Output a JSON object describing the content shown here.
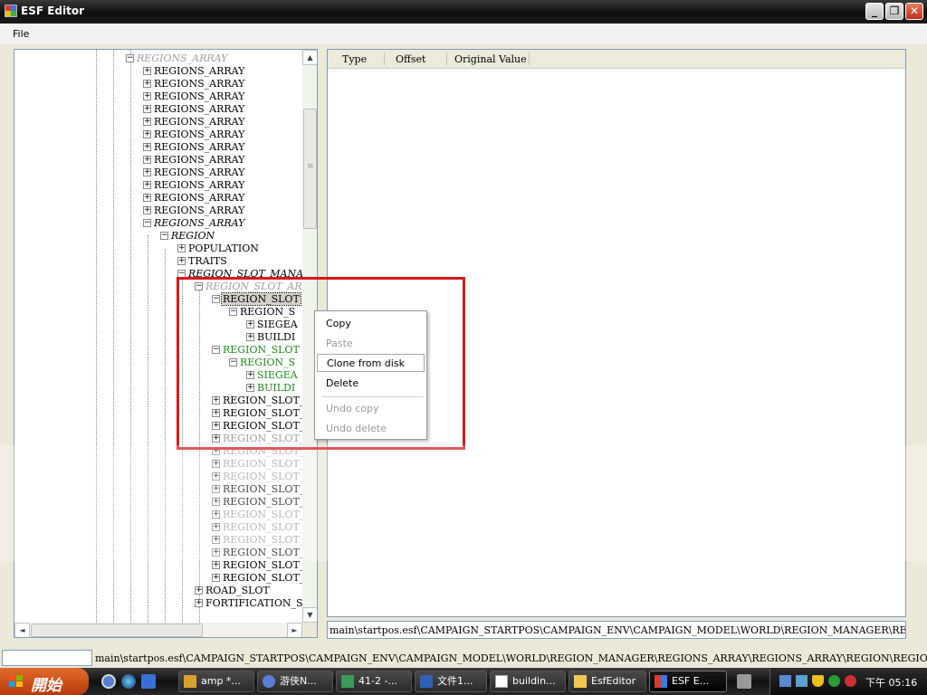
{
  "window": {
    "title": "ESF Editor",
    "min_glyph": "_",
    "max_glyph": "❐",
    "close_glyph": "✕"
  },
  "menu": {
    "file": "File"
  },
  "tree": {
    "nodes": [
      {
        "text": "REGIONS_ARRAY",
        "style": "gray italic",
        "exp": "−",
        "indent": 0
      },
      {
        "text": "REGIONS_ARRAY",
        "style": "",
        "exp": "+",
        "indent": 1
      },
      {
        "text": "REGIONS_ARRAY",
        "style": "",
        "exp": "+",
        "indent": 1
      },
      {
        "text": "REGIONS_ARRAY",
        "style": "",
        "exp": "+",
        "indent": 1
      },
      {
        "text": "REGIONS_ARRAY",
        "style": "",
        "exp": "+",
        "indent": 1
      },
      {
        "text": "REGIONS_ARRAY",
        "style": "",
        "exp": "+",
        "indent": 1
      },
      {
        "text": "REGIONS_ARRAY",
        "style": "",
        "exp": "+",
        "indent": 1
      },
      {
        "text": "REGIONS_ARRAY",
        "style": "",
        "exp": "+",
        "indent": 1
      },
      {
        "text": "REGIONS_ARRAY",
        "style": "",
        "exp": "+",
        "indent": 1
      },
      {
        "text": "REGIONS_ARRAY",
        "style": "",
        "exp": "+",
        "indent": 1
      },
      {
        "text": "REGIONS_ARRAY",
        "style": "",
        "exp": "+",
        "indent": 1
      },
      {
        "text": "REGIONS_ARRAY",
        "style": "",
        "exp": "+",
        "indent": 1
      },
      {
        "text": "REGIONS_ARRAY",
        "style": "",
        "exp": "+",
        "indent": 1
      },
      {
        "text": "REGIONS_ARRAY",
        "style": "italic",
        "exp": "−",
        "indent": 1
      },
      {
        "text": "REGION",
        "style": "italic",
        "exp": "−",
        "indent": 2
      },
      {
        "text": "POPULATION",
        "style": "",
        "exp": "+",
        "indent": 3
      },
      {
        "text": "TRAITS",
        "style": "",
        "exp": "+",
        "indent": 3
      },
      {
        "text": "REGION_SLOT_MANAG",
        "style": "italic",
        "exp": "−",
        "indent": 3
      },
      {
        "text": "REGION_SLOT_ARR",
        "style": "gray italic",
        "exp": "−",
        "indent": 4
      },
      {
        "text": "REGION_SLOT",
        "style": "sel",
        "exp": "−",
        "indent": 5
      },
      {
        "text": "REGION_S",
        "style": "",
        "exp": "−",
        "indent": 6
      },
      {
        "text": "SIEGEA",
        "style": "",
        "exp": "+",
        "indent": 7
      },
      {
        "text": "BUILDI",
        "style": "",
        "exp": "+",
        "indent": 7
      },
      {
        "text": "REGION_SLOT",
        "style": "green",
        "exp": "−",
        "indent": 5
      },
      {
        "text": "REGION_S",
        "style": "green",
        "exp": "−",
        "indent": 6
      },
      {
        "text": "SIEGEA",
        "style": "green",
        "exp": "+",
        "indent": 7
      },
      {
        "text": "BUILDI",
        "style": "green",
        "exp": "+",
        "indent": 7
      },
      {
        "text": "REGION_SLOT_",
        "style": "",
        "exp": "+",
        "indent": 5
      },
      {
        "text": "REGION_SLOT_",
        "style": "",
        "exp": "+",
        "indent": 5
      },
      {
        "text": "REGION_SLOT_",
        "style": "",
        "exp": "+",
        "indent": 5
      },
      {
        "text": "REGION_SLOT_",
        "style": "gray",
        "exp": "+",
        "indent": 5
      },
      {
        "text": "REGION_SLOT_",
        "style": "gray",
        "exp": "+",
        "indent": 5
      },
      {
        "text": "REGION_SLOT_",
        "style": "gray",
        "exp": "+",
        "indent": 5
      },
      {
        "text": "REGION_SLOT_",
        "style": "gray",
        "exp": "+",
        "indent": 5
      },
      {
        "text": "REGION_SLOT_",
        "style": "",
        "exp": "+",
        "indent": 5
      },
      {
        "text": "REGION_SLOT_",
        "style": "",
        "exp": "+",
        "indent": 5
      },
      {
        "text": "REGION_SLOT_",
        "style": "gray",
        "exp": "+",
        "indent": 5
      },
      {
        "text": "REGION_SLOT_",
        "style": "gray",
        "exp": "+",
        "indent": 5
      },
      {
        "text": "REGION_SLOT_",
        "style": "gray",
        "exp": "+",
        "indent": 5
      },
      {
        "text": "REGION_SLOT_",
        "style": "",
        "exp": "+",
        "indent": 5
      },
      {
        "text": "REGION_SLOT_",
        "style": "",
        "exp": "+",
        "indent": 5
      },
      {
        "text": "REGION_SLOT_",
        "style": "",
        "exp": "+",
        "indent": 5
      },
      {
        "text": "ROAD_SLOT",
        "style": "",
        "exp": "+",
        "indent": 4
      },
      {
        "text": "FORTIFICATION_SL",
        "style": "",
        "exp": "+",
        "indent": 4
      }
    ],
    "scroll_up": "▲",
    "scroll_down": "▼",
    "scroll_left": "◄",
    "scroll_right": "►",
    "grip": "≡"
  },
  "list": {
    "columns": [
      "Type",
      "Offset",
      "Original Value"
    ]
  },
  "path_box": "main\\startpos.esf\\CAMPAIGN_STARTPOS\\CAMPAIGN_ENV\\CAMPAIGN_MODEL\\WORLD\\REGION_MANAGER\\REGIONS_ARR",
  "status_path": "main\\startpos.esf\\CAMPAIGN_STARTPOS\\CAMPAIGN_ENV\\CAMPAIGN_MODEL\\WORLD\\REGION_MANAGER\\REGIONS_ARRAY\\REGIONS_ARRAY\\REGION\\REGION_SLOT_MANAGER\\REGION_S",
  "context_menu": {
    "copy": "Copy",
    "paste": "Paste",
    "clone": "Clone from disk",
    "delete": "Delete",
    "undo_copy": "Undo copy",
    "undo_delete": "Undo delete"
  },
  "taskbar": {
    "start": "開始",
    "tasks": [
      "amp *...",
      "游侠N...",
      "41-2 -...",
      "文件1...",
      "buildin...",
      "EsfEditor",
      "ESF E..."
    ],
    "clock": "下午 05:16"
  },
  "colors": {
    "highlight_box": "#d61a1a",
    "green_node": "#1b8a1b",
    "gray_node": "#a0a0a0"
  }
}
